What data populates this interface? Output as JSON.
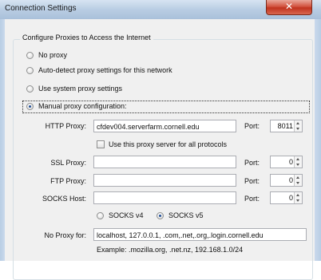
{
  "window": {
    "title": "Connection Settings",
    "close_glyph": "✕"
  },
  "group_title": "Configure Proxies to Access the Internet",
  "options": {
    "no_proxy": "No proxy",
    "auto_detect": "Auto-detect proxy settings for this network",
    "system": "Use system proxy settings",
    "manual": "Manual proxy configuration:",
    "selected": "manual"
  },
  "http": {
    "label": "HTTP Proxy:",
    "value": "cfdev004.serverfarm.cornell.edu",
    "port_label": "Port:",
    "port": "8011"
  },
  "use_all": {
    "label": "Use this proxy server for all protocols",
    "checked": false
  },
  "ssl": {
    "label": "SSL Proxy:",
    "value": "",
    "port_label": "Port:",
    "port": "0"
  },
  "ftp": {
    "label": "FTP Proxy:",
    "value": "",
    "port_label": "Port:",
    "port": "0"
  },
  "socks": {
    "label": "SOCKS Host:",
    "value": "",
    "port_label": "Port:",
    "port": "0",
    "v4": "SOCKS v4",
    "v5": "SOCKS v5",
    "selected": "v5"
  },
  "no_proxy_for": {
    "label": "No Proxy for:",
    "value": "localhost, 127.0.0.1, .com,.net,.org,.login.cornell.edu"
  },
  "example": "Example: .mozilla.org, .net.nz, 192.168.1.0/24",
  "colors": {
    "title_bar": "#b9cde3",
    "close": "#c0331e",
    "radio_dot": "#1f4e96"
  }
}
